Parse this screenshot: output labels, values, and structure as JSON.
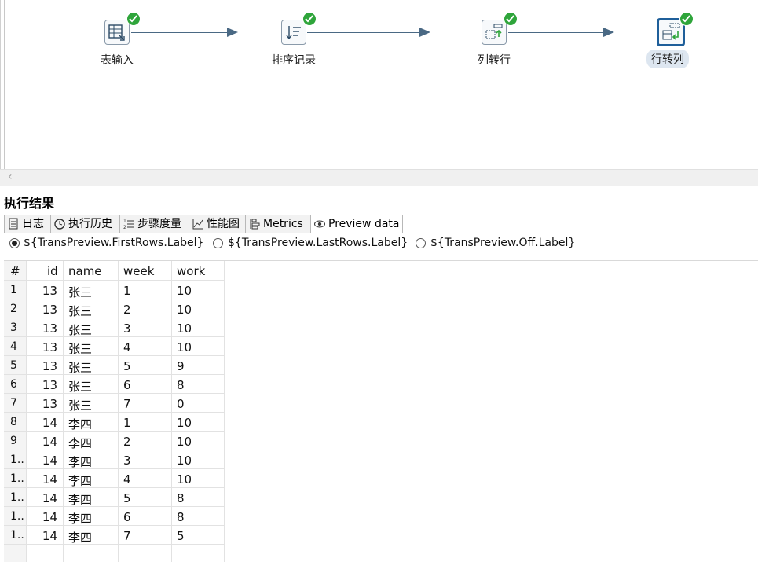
{
  "steps": [
    {
      "label": "表输入",
      "icon": "table-input-icon",
      "selected": false
    },
    {
      "label": "排序记录",
      "icon": "sort-rows-icon",
      "selected": false
    },
    {
      "label": "列转行",
      "icon": "row-normaliser-icon",
      "selected": false
    },
    {
      "label": "行转列",
      "icon": "row-denormaliser-icon",
      "selected": true
    }
  ],
  "panel_title": "执行结果",
  "tabs": [
    {
      "label": "日志",
      "icon": "log-icon"
    },
    {
      "label": "执行历史",
      "icon": "history-icon"
    },
    {
      "label": "步骤度量",
      "icon": "step-metrics-icon"
    },
    {
      "label": "性能图",
      "icon": "performance-chart-icon"
    },
    {
      "label": "Metrics",
      "icon": "metrics-icon"
    },
    {
      "label": "Preview data",
      "icon": "eye-icon",
      "active": true
    }
  ],
  "preview_options": [
    {
      "label": "${TransPreview.FirstRows.Label}",
      "selected": true
    },
    {
      "label": "${TransPreview.LastRows.Label}",
      "selected": false
    },
    {
      "label": "${TransPreview.Off.Label}",
      "selected": false
    }
  ],
  "table": {
    "columns": [
      "#",
      "id",
      "name",
      "week",
      "work"
    ],
    "rows": [
      [
        "1",
        "13",
        "张三",
        "1",
        "10"
      ],
      [
        "2",
        "13",
        "张三",
        "2",
        "10"
      ],
      [
        "3",
        "13",
        "张三",
        "3",
        "10"
      ],
      [
        "4",
        "13",
        "张三",
        "4",
        "10"
      ],
      [
        "5",
        "13",
        "张三",
        "5",
        "9"
      ],
      [
        "6",
        "13",
        "张三",
        "6",
        "8"
      ],
      [
        "7",
        "13",
        "张三",
        "7",
        "0"
      ],
      [
        "8",
        "14",
        "李四",
        "1",
        "10"
      ],
      [
        "9",
        "14",
        "李四",
        "2",
        "10"
      ],
      [
        "1..",
        "14",
        "李四",
        "3",
        "10"
      ],
      [
        "1..",
        "14",
        "李四",
        "4",
        "10"
      ],
      [
        "1..",
        "14",
        "李四",
        "5",
        "8"
      ],
      [
        "1..",
        "14",
        "李四",
        "6",
        "8"
      ],
      [
        "1..",
        "14",
        "李四",
        "7",
        "5"
      ]
    ]
  },
  "colors": {
    "hop": "#4a6984",
    "ok": "#2fa53b",
    "selected_border": "#1f5f9a"
  }
}
